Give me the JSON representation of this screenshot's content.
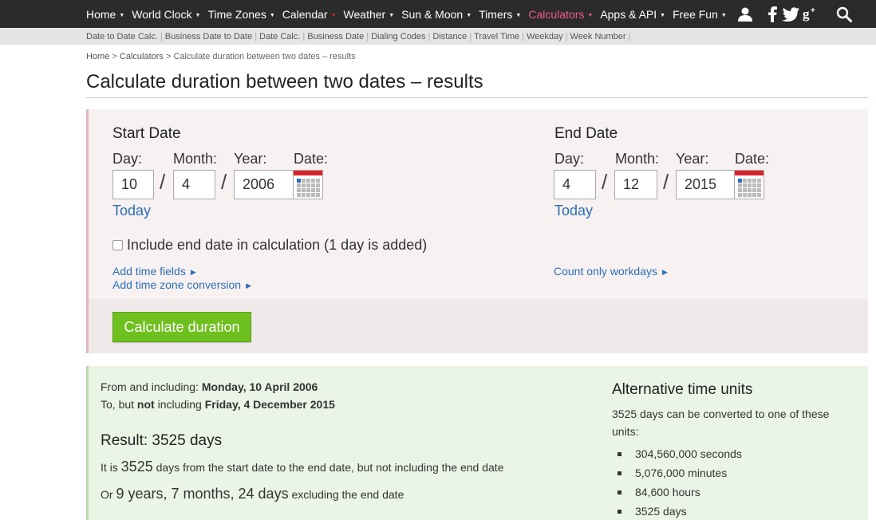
{
  "nav": {
    "items": [
      {
        "label": "Home",
        "active": false
      },
      {
        "label": "World Clock",
        "active": false
      },
      {
        "label": "Time Zones",
        "active": false
      },
      {
        "label": "Calendar",
        "active": false
      },
      {
        "label": "Weather",
        "active": false
      },
      {
        "label": "Sun & Moon",
        "active": false
      },
      {
        "label": "Timers",
        "active": false
      },
      {
        "label": "Calculators",
        "active": true
      },
      {
        "label": "Apps & API",
        "active": false
      },
      {
        "label": "Free Fun",
        "active": false
      }
    ],
    "icons": [
      "user-icon",
      "facebook-icon",
      "twitter-icon",
      "google-plus-icon",
      "search-icon"
    ],
    "accent_color": "#f05a8a"
  },
  "subnav": {
    "items": [
      "Date to Date Calc.",
      "Business Date to Date",
      "Date Calc.",
      "Business Date",
      "Dialing Codes",
      "Distance",
      "Travel Time",
      "Weekday",
      "Week Number"
    ]
  },
  "breadcrumb": {
    "home": "Home",
    "calculators": "Calculators",
    "current": "Calculate duration between two dates – results",
    "separator": ">"
  },
  "page": {
    "title": "Calculate duration between two dates – results"
  },
  "form": {
    "start": {
      "title": "Start Date",
      "day_label": "Day:",
      "month_label": "Month:",
      "year_label": "Year:",
      "date_label": "Date:",
      "day": "10",
      "month": "4",
      "year": "2006",
      "today": "Today"
    },
    "end": {
      "title": "End Date",
      "day_label": "Day:",
      "month_label": "Month:",
      "year_label": "Year:",
      "date_label": "Date:",
      "day": "4",
      "month": "12",
      "year": "2015",
      "today": "Today"
    },
    "slash": "/",
    "include_end_label": "Include end date in calculation (1 day is added)",
    "add_time_fields": "Add time fields",
    "add_time_zone": "Add time zone conversion",
    "count_workdays": "Count only workdays",
    "calculate_button": "Calculate duration",
    "button_color": "#6ec01e"
  },
  "result": {
    "from_prefix": "From and including: ",
    "from_date": "Monday, 10 April 2006",
    "to_prefix": "To, but ",
    "to_not": "not",
    "to_mid": " including ",
    "to_date": "Friday, 4 December 2015",
    "title": "Result: 3525 days",
    "line1_prefix": "It is ",
    "line1_days": "3525",
    "line1_suffix": " days from the start date to the end date, but not including the end date",
    "line2_prefix": "Or ",
    "line2_years": "9 years, 7 months, 24 days",
    "line2_suffix": " excluding the end date"
  },
  "alt": {
    "title": "Alternative time units",
    "desc": "3525 days can be converted to one of these units:",
    "units": [
      "304,560,000 seconds",
      "5,076,000 minutes",
      "84,600 hours",
      "3525 days"
    ]
  }
}
